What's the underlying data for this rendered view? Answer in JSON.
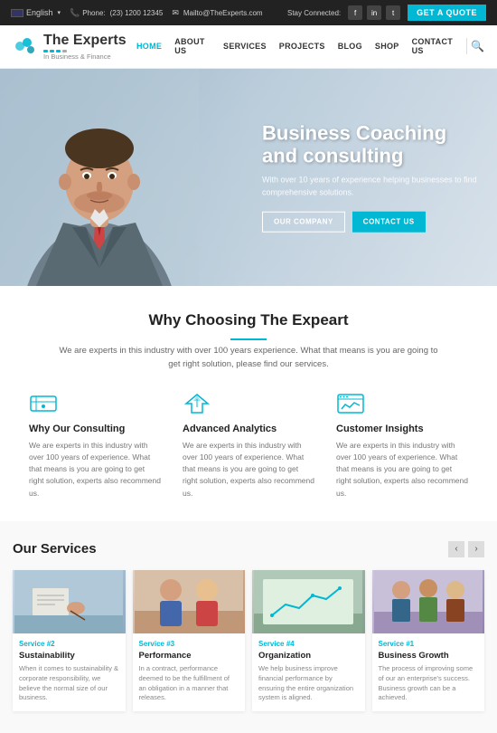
{
  "topbar": {
    "language": "English",
    "phone_label": "Phone:",
    "phone": "(23) 1200 12345",
    "email": "Mailto@TheExperts.com",
    "stay_connected": "Stay Connected:",
    "quote_btn": "GET A QUOTE",
    "social": [
      "f",
      "in",
      "t"
    ]
  },
  "header": {
    "logo_title": "The Experts",
    "logo_sub": "In Business & Finance",
    "nav": [
      "HOME",
      "ABOUT US",
      "SERVICES",
      "PROJECTS",
      "BLOG",
      "SHOP",
      "CONTACT US"
    ]
  },
  "hero": {
    "title": "Business Coaching and consulting",
    "subtitle": "With over 10 years of experience helping businesses to find comprehensive solutions.",
    "btn1": "OUR COMPANY",
    "btn2": "CONTACT US"
  },
  "why": {
    "title": "Why Choosing The Expeart",
    "desc": "We are experts in this industry with over 100 years experience. What that means is you are going to get right solution, please find our services.",
    "cards": [
      {
        "title": "Why Our Consulting",
        "desc": "We are experts in this industry with over 100 years of experience. What that means is you are going to get right solution, experts also recommend us."
      },
      {
        "title": "Advanced Analytics",
        "desc": "We are experts in this industry with over 100 years of experience. What that means is you are going to get right solution, experts also recommend us."
      },
      {
        "title": "Customer Insights",
        "desc": "We are experts in this industry with over 100 years of experience. What that means is you are going to get right solution, experts also recommend us."
      }
    ]
  },
  "services": {
    "title": "Our Services",
    "cards": [
      {
        "label": "Service #2",
        "title": "Sustainability",
        "desc": "When it comes to sustainability & corporate responsibility, we believe the normal size of our business."
      },
      {
        "label": "Service #3",
        "title": "Performance",
        "desc": "In a contract, performance deemed to be the fulfillment of an obligation in a manner that releases."
      },
      {
        "label": "Service #4",
        "title": "Organization",
        "desc": "We help business improve financial performance by ensuring the entire organization system is aligned."
      },
      {
        "label": "Service #1",
        "title": "Business Growth",
        "desc": "The process of improving some of our an enterprise's success. Business growth can be a achieved."
      }
    ]
  },
  "colors": {
    "accent": "#00b8d4",
    "dark": "#222222",
    "text_muted": "#777777"
  }
}
